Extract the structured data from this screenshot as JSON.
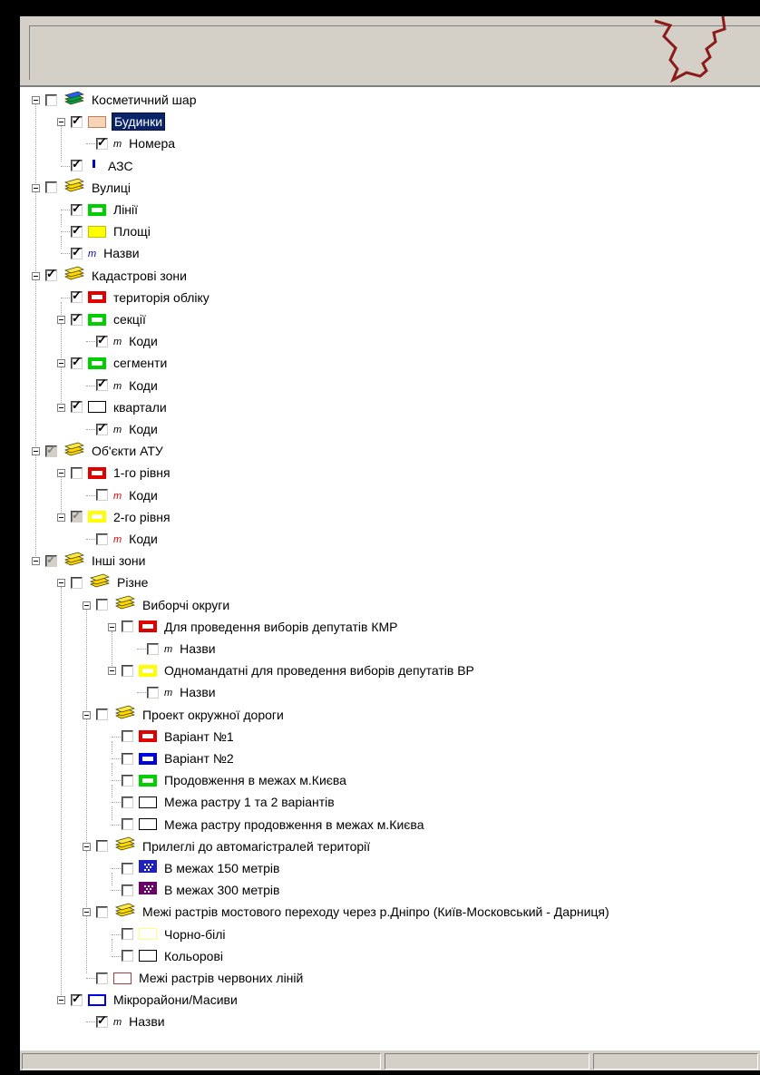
{
  "colors": {
    "red": "#e00000",
    "green": "#00d000",
    "yellow": "#ffff00",
    "blue": "#0000e0",
    "white": "#ffffff",
    "darkred": "#a04040",
    "purple": "#6a006a"
  },
  "tree": [
    {
      "level": 0,
      "check": "none",
      "icon": "layers-green-icon",
      "label": "Косметичний шар",
      "exp": true
    },
    {
      "level": 1,
      "check": "checked",
      "icon": "swatch",
      "swatch": "#f5d5b5",
      "swatchBorder": "#c08060",
      "label": "Будинки",
      "exp": true,
      "selected": true
    },
    {
      "level": 2,
      "check": "checked",
      "icon": "text",
      "textColor": "#000000",
      "label": "Номера"
    },
    {
      "level": 1,
      "check": "checked",
      "icon": "bar",
      "barColor": "#0000c0",
      "label": "АЗС"
    },
    {
      "level": 0,
      "check": "none",
      "icon": "layers-yellow-icon",
      "label": "Вулиці",
      "exp": true
    },
    {
      "level": 1,
      "check": "checked",
      "icon": "swatch",
      "swatch": "#ffffff",
      "swatchBorder": "#00d000",
      "label": "Лінії"
    },
    {
      "level": 1,
      "check": "checked",
      "icon": "swatch",
      "swatch": "#ffff00",
      "swatchBorder": "#00d000",
      "label": "Площі"
    },
    {
      "level": 1,
      "check": "checked",
      "icon": "text",
      "textColor": "#0000c0",
      "label": "Назви"
    },
    {
      "level": 0,
      "check": "checked",
      "icon": "layers-yellow-icon",
      "label": "Кадастрові зони",
      "exp": true
    },
    {
      "level": 1,
      "check": "checked",
      "icon": "swatch",
      "swatch": "#ffffff",
      "swatchBorder": "#e00000",
      "label": "територія обліку"
    },
    {
      "level": 1,
      "check": "checked",
      "icon": "swatch",
      "swatch": "#ffffff",
      "swatchBorder": "#00d000",
      "label": "секції",
      "exp": true
    },
    {
      "level": 2,
      "check": "checked",
      "icon": "text",
      "textColor": "#000000",
      "label": "Коди"
    },
    {
      "level": 1,
      "check": "checked",
      "icon": "swatch",
      "swatch": "#ffffff",
      "swatchBorder": "#00d000",
      "label": "сегменти",
      "exp": true
    },
    {
      "level": 2,
      "check": "checked",
      "icon": "text",
      "textColor": "#000000",
      "label": "Коди"
    },
    {
      "level": 1,
      "check": "checked",
      "icon": "swatch",
      "swatch": "#ffffff",
      "swatchBorder": "#000000",
      "thin": true,
      "label": "квартали",
      "exp": true
    },
    {
      "level": 2,
      "check": "checked",
      "icon": "text",
      "textColor": "#000000",
      "label": "Коди"
    },
    {
      "level": 0,
      "check": "partial",
      "icon": "layers-yellow-icon",
      "label": "Об'єкти АТУ",
      "exp": true
    },
    {
      "level": 1,
      "check": "none",
      "icon": "swatch",
      "swatch": "#ffffff",
      "swatchBorder": "#e00000",
      "label": "1-го рівня",
      "exp": true
    },
    {
      "level": 2,
      "check": "none",
      "icon": "text",
      "textColor": "#e00000",
      "label": "Коди"
    },
    {
      "level": 1,
      "check": "partial",
      "icon": "swatch",
      "swatch": "#ffffff",
      "swatchBorder": "#ffff00",
      "label": "2-го рівня",
      "exp": true
    },
    {
      "level": 2,
      "check": "none",
      "icon": "text",
      "textColor": "#e00000",
      "label": "Коди"
    },
    {
      "level": 0,
      "check": "partial",
      "icon": "layers-yellow-icon",
      "label": "Інші зони",
      "exp": true
    },
    {
      "level": 1,
      "check": "none",
      "icon": "layers-yellow-icon",
      "label": "Різне",
      "exp": true
    },
    {
      "level": 2,
      "check": "none",
      "icon": "layers-yellow-icon",
      "label": "Виборчі округи",
      "exp": true
    },
    {
      "level": 3,
      "check": "none",
      "icon": "swatch",
      "swatch": "#ffffff",
      "swatchBorder": "#e00000",
      "label": "Для проведення виборів депутатів КМР",
      "exp": true
    },
    {
      "level": 4,
      "check": "none",
      "icon": "text",
      "textColor": "#000000",
      "label": "Назви"
    },
    {
      "level": 3,
      "check": "none",
      "icon": "swatch",
      "swatch": "#ffffff",
      "swatchBorder": "#ffff00",
      "label": "Одномандатні для проведення виборів депутатів ВР",
      "exp": true
    },
    {
      "level": 4,
      "check": "none",
      "icon": "text",
      "textColor": "#000000",
      "label": "Назви"
    },
    {
      "level": 2,
      "check": "none",
      "icon": "layers-yellow-icon",
      "label": "Проект окружної дороги",
      "exp": true
    },
    {
      "level": 3,
      "check": "none",
      "icon": "swatch",
      "swatch": "#ffffff",
      "swatchBorder": "#e00000",
      "label": "Варіант №1"
    },
    {
      "level": 3,
      "check": "none",
      "icon": "swatch",
      "swatch": "#ffffff",
      "swatchBorder": "#0000e0",
      "label": "Варіант №2"
    },
    {
      "level": 3,
      "check": "none",
      "icon": "swatch",
      "swatch": "#ffffff",
      "swatchBorder": "#00d000",
      "label": "Продовження в межах м.Києва"
    },
    {
      "level": 3,
      "check": "none",
      "icon": "swatch",
      "swatch": "#ffffff",
      "swatchBorder": "#000000",
      "thin": true,
      "label": "Межа растру 1 та 2 варіантів"
    },
    {
      "level": 3,
      "check": "none",
      "icon": "swatch",
      "swatch": "#ffffff",
      "swatchBorder": "#000000",
      "thin": true,
      "label": "Межа растру продовження в межах м.Києва"
    },
    {
      "level": 2,
      "check": "none",
      "icon": "layers-yellow-icon",
      "label": "Прилеглі до автомагістралей території",
      "exp": true
    },
    {
      "level": 3,
      "check": "none",
      "icon": "pattern",
      "patternColor": "#2020c0",
      "label": "В межах 150 метрів"
    },
    {
      "level": 3,
      "check": "none",
      "icon": "pattern",
      "patternColor": "#6a006a",
      "label": "В межах 300 метрів"
    },
    {
      "level": 2,
      "check": "none",
      "icon": "layers-yellow-icon",
      "label": "Межі растрів мостового переходу через р.Дніпро (Київ-Московський - Дарниця)",
      "exp": true
    },
    {
      "level": 3,
      "check": "none",
      "icon": "swatch",
      "swatch": "#ffffff",
      "swatchBorder": "#ffff80",
      "thin": true,
      "label": "Чорно-білі"
    },
    {
      "level": 3,
      "check": "none",
      "icon": "swatch",
      "swatch": "#ffffff",
      "swatchBorder": "#000000",
      "thin": true,
      "label": "Кольорові"
    },
    {
      "level": 2,
      "check": "none",
      "icon": "swatch",
      "swatch": "#ffffff",
      "swatchBorder": "#a04040",
      "thin": true,
      "label": "Межі растрів червоних ліній"
    },
    {
      "level": 1,
      "check": "checked",
      "icon": "swatch",
      "swatch": "#ffffff",
      "swatchBorder": "#0000e0",
      "thinMid": true,
      "label": "Мікрорайони/Масиви",
      "exp": true
    },
    {
      "level": 2,
      "check": "checked",
      "icon": "text",
      "textColor": "#000000",
      "label": "Назви"
    }
  ]
}
